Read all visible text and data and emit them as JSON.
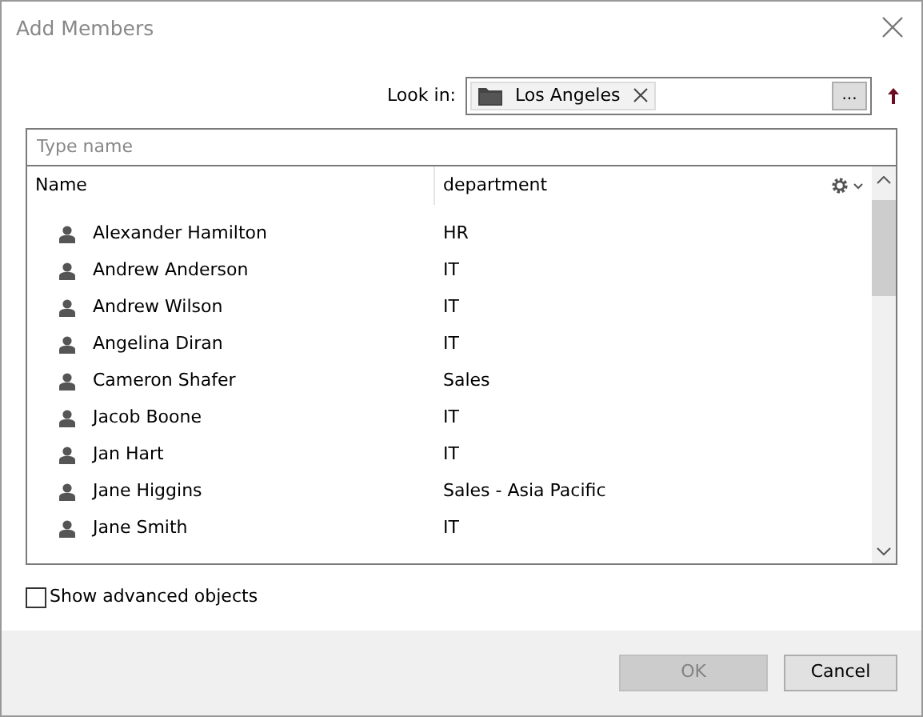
{
  "window": {
    "title": "Add Members"
  },
  "look_in": {
    "label": "Look in:",
    "token": "Los Angeles",
    "browse_button": "..."
  },
  "search": {
    "placeholder": "Type name"
  },
  "table": {
    "columns": [
      "Name",
      "department"
    ],
    "rows": [
      {
        "name": "Alexander Hamilton",
        "department": "HR"
      },
      {
        "name": "Andrew Anderson",
        "department": "IT"
      },
      {
        "name": "Andrew Wilson",
        "department": "IT"
      },
      {
        "name": "Angelina Diran",
        "department": "IT"
      },
      {
        "name": "Cameron Shafer",
        "department": "Sales"
      },
      {
        "name": "Jacob Boone",
        "department": "IT"
      },
      {
        "name": "Jan Hart",
        "department": "IT"
      },
      {
        "name": "Jane Higgins",
        "department": "Sales - Asia Pacific"
      },
      {
        "name": "Jane Smith",
        "department": "IT"
      }
    ]
  },
  "advanced": {
    "label": "Show advanced objects",
    "checked": false
  },
  "buttons": [
    {
      "label": "OK",
      "disabled": true
    },
    {
      "label": "Cancel",
      "disabled": false
    }
  ]
}
